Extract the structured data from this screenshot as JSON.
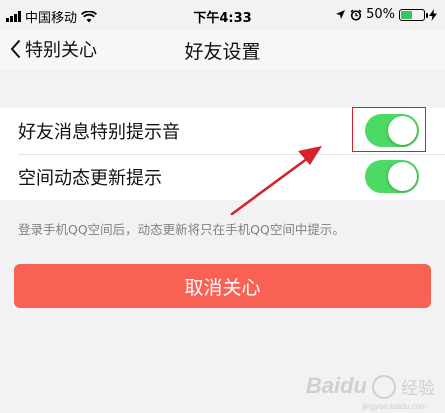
{
  "status_bar": {
    "carrier": "中国移动",
    "time": "下午4:33",
    "battery_percent": "50%",
    "battery_level": 0.5,
    "icons": [
      "signal-icon",
      "wifi-icon",
      "location-icon",
      "alarm-icon",
      "battery-icon",
      "charging-icon"
    ]
  },
  "nav": {
    "back_label": "特别关心",
    "title": "好友设置"
  },
  "settings": {
    "items": [
      {
        "label": "好友消息特别提示音",
        "enabled": true
      },
      {
        "label": "空间动态更新提示",
        "enabled": true
      }
    ],
    "hint": "登录手机QQ空间后，动态更新将只在手机QQ空间中提示。"
  },
  "actions": {
    "cancel_label": "取消关心"
  },
  "colors": {
    "toggle_on": "#4cd964",
    "cancel_button": "#f86255",
    "annotation": "#d6212a",
    "background": "#f2f2f5"
  },
  "watermark": {
    "brand": "Baidu",
    "text": "经验",
    "url": "jingyan.baidu.com"
  }
}
